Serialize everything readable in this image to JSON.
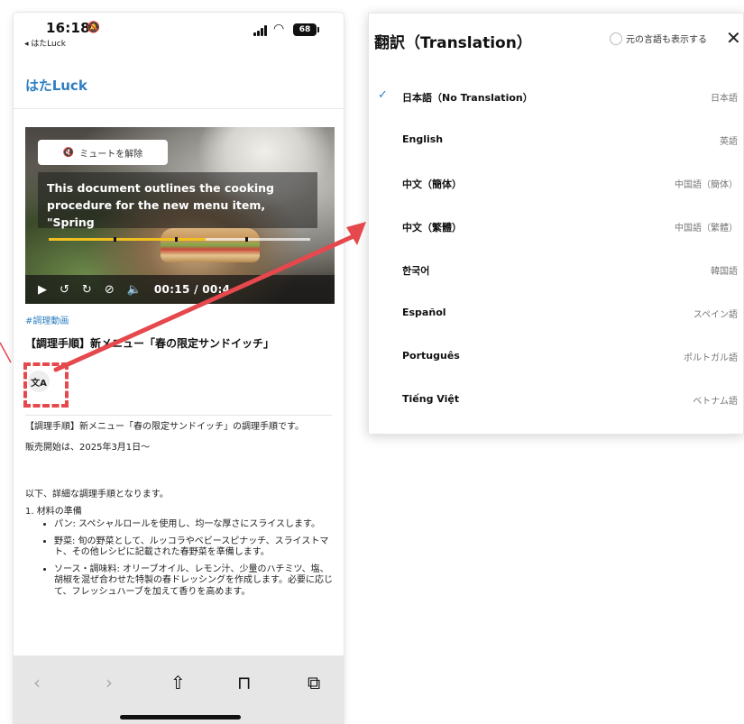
{
  "status_bar": {
    "time": "16:18",
    "back_app": "◂ はたLuck",
    "battery": "68"
  },
  "app": {
    "logo": "はたLuck"
  },
  "video": {
    "mute_label": "ミュートを解除",
    "caption": "This document outlines the cooking procedure for the new menu item, \"Spring",
    "timecode": "00:15 / 00:4",
    "progress": 0.6
  },
  "post": {
    "hashtag": "#調理動画",
    "title": "【調理手順】新メニュー「春の限定サンドイッチ」",
    "translate_icon": "文A",
    "intro": "【調理手順】新メニュー「春の限定サンドイッチ」の調理手順です。",
    "sale_start": "販売開始は、2025年3月1日〜",
    "details": "以下、詳細な調理手順となります。",
    "step1_title": "1. 材料の準備",
    "bullets": [
      "パン: スペシャルロールを使用し、均一な厚さにスライスします。",
      "野菜: 旬の野菜として、ルッコラやベビースピナッチ、スライストマト、その他レシピに記載された春野菜を準備します。",
      "ソース・調味料: オリーブオイル、レモン汁、少量のハチミツ、塩、胡椒を混ぜ合わせた特製の春ドレッシングを作成します。必要に応じて、フレッシュハーブを加えて香りを高めます。"
    ]
  },
  "toolbar": {
    "icons": [
      "chevron-left-icon",
      "chevron-right-icon",
      "share-icon",
      "book-icon",
      "tabs-icon"
    ]
  },
  "translation_panel": {
    "title": "翻訳（Translation）",
    "show_original": "元の言語も表示する",
    "close": "✕",
    "selected_index": 0,
    "languages": [
      {
        "name": "日本語（No Translation）",
        "native": "日本語"
      },
      {
        "name": "English",
        "native": "英語"
      },
      {
        "name": "中文（簡体）",
        "native": "中国語（簡体）"
      },
      {
        "name": "中文（繁體）",
        "native": "中国語（繁體）"
      },
      {
        "name": "한국어",
        "native": "韓国語"
      },
      {
        "name": "Español",
        "native": "スペイン語"
      },
      {
        "name": "Português",
        "native": "ポルトガル語"
      },
      {
        "name": "Tiếng Việt",
        "native": "ベトナム語"
      }
    ]
  },
  "colors": {
    "accent": "#2f7fc1",
    "highlight": "#e5484d",
    "progress": "#f0c020"
  }
}
